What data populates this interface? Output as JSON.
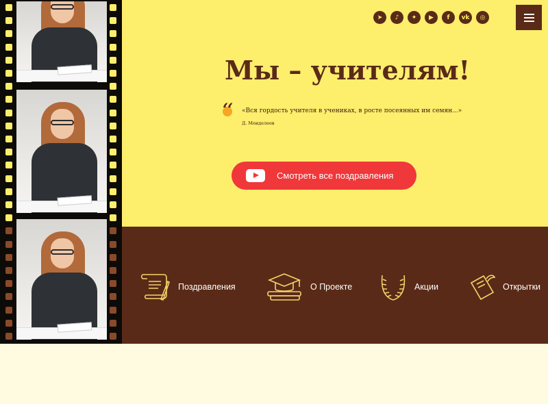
{
  "header": {
    "social_icons": [
      {
        "name": "telegram-icon",
        "glyph": "➤"
      },
      {
        "name": "tiktok-icon",
        "glyph": "♪"
      },
      {
        "name": "dzen-icon",
        "glyph": "✦"
      },
      {
        "name": "youtube-icon",
        "glyph": "▶"
      },
      {
        "name": "facebook-icon",
        "glyph": "f"
      },
      {
        "name": "vk-icon",
        "glyph": "vk"
      },
      {
        "name": "instagram-icon",
        "glyph": "◎"
      }
    ],
    "menu_icon": "hamburger-icon"
  },
  "hero": {
    "title": "Мы – учителям!",
    "quote": "«Вся гордость учителя в учениках, в росте посеянных им семян...»",
    "author": "Д. Менделеев",
    "watch_button": "Смотреть все поздравления"
  },
  "nav": [
    {
      "label": "Поздравления",
      "icon": "scroll-quill-icon"
    },
    {
      "label": "О Проекте",
      "icon": "graduation-cap-books-icon"
    },
    {
      "label": "Акции",
      "icon": "laurel-wreath-icon"
    },
    {
      "label": "Открытки",
      "icon": "postcard-icon"
    }
  ],
  "colors": {
    "hero_bg": "#fdee6c",
    "brown": "#5a2a18",
    "cream": "#fffbe0",
    "button_red": "#f0373a",
    "icon_gold": "#f5d56a"
  }
}
